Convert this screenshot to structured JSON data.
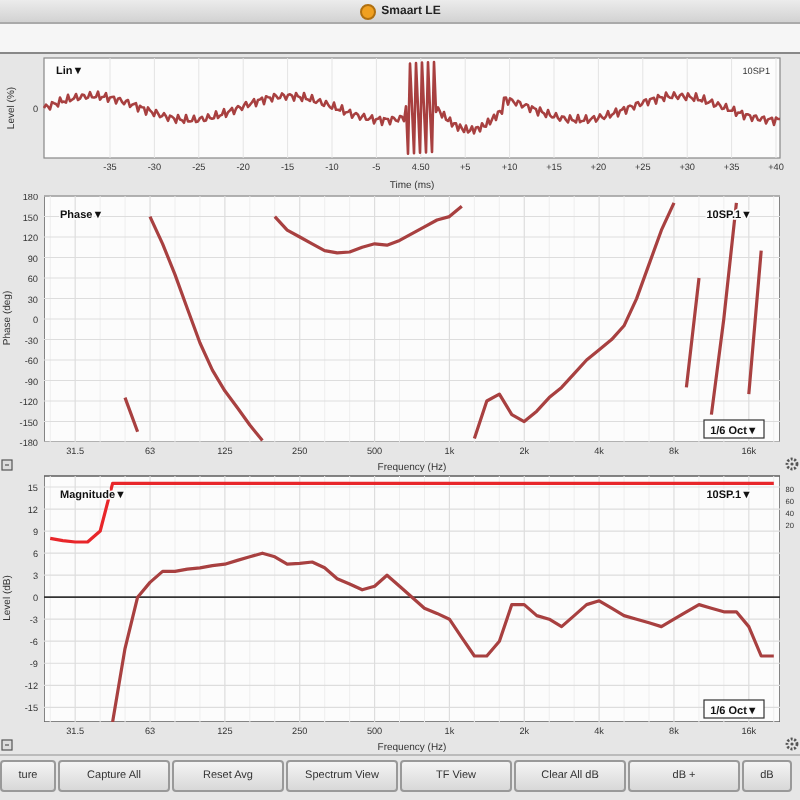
{
  "window": {
    "title": "Smaart LE"
  },
  "time_plot": {
    "mode": "Lin▼",
    "trace": "10SP1",
    "ylabel": "Level (%)",
    "xlabel": "Time (ms)",
    "yticks": [
      "0"
    ],
    "xticks": [
      "-35",
      "-30",
      "-25",
      "-20",
      "-15",
      "-10",
      "-5",
      "4.50",
      "+5",
      "+10",
      "+15",
      "+20",
      "+25",
      "+30",
      "+35",
      "+40"
    ]
  },
  "phase_plot": {
    "mode": "Phase▼",
    "trace": "10SP.1▼",
    "smoothing": "1/6 Oct▼",
    "chart_data": {
      "type": "line",
      "xlabel": "Frequency (Hz)",
      "ylabel": "Phase (deg)",
      "categories": [
        null,
        null,
        "31.5",
        null,
        null,
        null,
        null,
        null,
        "63",
        null,
        null,
        null,
        null,
        null,
        "125",
        null,
        null,
        null,
        null,
        null,
        "250",
        null,
        null,
        null,
        null,
        null,
        "500",
        null,
        null,
        null,
        null,
        null,
        "1k",
        null,
        null,
        null,
        null,
        null,
        "2k",
        null,
        null,
        null,
        null,
        null,
        "4k",
        null,
        null,
        null,
        null,
        null,
        "8k",
        null,
        null,
        null,
        null,
        null,
        "16k",
        null,
        null
      ],
      "series": [
        {
          "color": "#a84040",
          "values": [
            null,
            null,
            null,
            null,
            null,
            null,
            -115,
            -165,
            null,
            null,
            null,
            null,
            null,
            null,
            null,
            null,
            null,
            null,
            150,
            130,
            120,
            110,
            100,
            97,
            98,
            105,
            110,
            108,
            115,
            125,
            135,
            145,
            150,
            165,
            null,
            null,
            null,
            null,
            null,
            null,
            null,
            null,
            null,
            null,
            null,
            null,
            null,
            null,
            null,
            null,
            null,
            -100,
            60,
            null,
            null,
            null,
            -110,
            100,
            null
          ]
        },
        {
          "color": "#a84040",
          "values": [
            null,
            null,
            null,
            null,
            null,
            null,
            null,
            null,
            150,
            110,
            65,
            15,
            -35,
            -75,
            -105,
            -130,
            -155,
            -178,
            null,
            null,
            null,
            null,
            null,
            null,
            null,
            null,
            null,
            null,
            null,
            null,
            null,
            null,
            null,
            null,
            -175,
            -120,
            -110,
            -140,
            -150,
            -135,
            -115,
            -100,
            -80,
            -60,
            -45,
            -30,
            -10,
            30,
            80,
            130,
            170,
            null,
            null,
            -140,
            0,
            170,
            null,
            null,
            null
          ]
        }
      ],
      "grid": true,
      "ylim": [
        -180,
        180
      ],
      "yticks": [
        180,
        150,
        120,
        90,
        60,
        30,
        0,
        -30,
        -60,
        -90,
        -120,
        -150,
        -180
      ]
    }
  },
  "magnitude_plot": {
    "mode": "Magnitude▼",
    "trace": "10SP.1▼",
    "smoothing": "1/6 Oct▼",
    "coherence_ticks": [
      "80",
      "60",
      "40",
      "20"
    ],
    "chart_data": {
      "type": "line",
      "xlabel": "Frequency (Hz)",
      "ylabel": "Level (dB)",
      "categories": [
        null,
        null,
        "31.5",
        null,
        null,
        null,
        null,
        null,
        "63",
        null,
        null,
        null,
        null,
        null,
        "125",
        null,
        null,
        null,
        null,
        null,
        "250",
        null,
        null,
        null,
        null,
        null,
        "500",
        null,
        null,
        null,
        null,
        null,
        "1k",
        null,
        null,
        null,
        null,
        null,
        "2k",
        null,
        null,
        null,
        null,
        null,
        "4k",
        null,
        null,
        null,
        null,
        null,
        "8k",
        null,
        null,
        null,
        null,
        null,
        "16k",
        null,
        null
      ],
      "series": [
        {
          "color": "#e8262a",
          "values": [
            8,
            7.7,
            7.5,
            7.5,
            9,
            15.5,
            15.5,
            15.5,
            15.5,
            15.5,
            15.5,
            15.5,
            15.5,
            15.5,
            15.5,
            15.5,
            15.5,
            15.5,
            15.5,
            15.5,
            15.5,
            15.5,
            15.5,
            15.5,
            15.5,
            15.5,
            15.5,
            15.5,
            15.5,
            15.5,
            15.5,
            15.5,
            15.5,
            15.5,
            15.5,
            15.5,
            15.5,
            15.5,
            15.5,
            15.5,
            15.5,
            15.5,
            15.5,
            15.5,
            15.5,
            15.5,
            15.5,
            15.5,
            15.5,
            15.5,
            15.5,
            15.5,
            15.5,
            15.5,
            15.5,
            15.5,
            15.5,
            15.5,
            15.5
          ]
        },
        {
          "color": "#a84040",
          "values": [
            null,
            null,
            null,
            null,
            null,
            -17,
            -7,
            0,
            2,
            3.5,
            3.5,
            3.8,
            4,
            4.3,
            4.5,
            5,
            5.5,
            6,
            5.5,
            4.5,
            4.6,
            4.8,
            4,
            2.5,
            1.8,
            1,
            1.5,
            3,
            1.5,
            0,
            -1.5,
            -2.2,
            -3,
            -5.5,
            -8,
            -8,
            -6,
            -1,
            -1,
            -2.5,
            -3,
            -4,
            -2.5,
            -1,
            -0.5,
            -1.5,
            -2.5,
            -3,
            -3.5,
            -4,
            -3,
            -2,
            -1,
            -1.5,
            -2,
            -2,
            -4,
            -8,
            -8
          ]
        }
      ],
      "grid": true,
      "ylim": [
        -17,
        16.5
      ],
      "yticks": [
        15,
        12,
        9,
        6,
        3,
        0,
        -3,
        -6,
        -9,
        -12,
        -15
      ]
    }
  },
  "buttons": [
    "ture",
    "Capture All",
    "Reset Avg",
    "Spectrum View",
    "TF View",
    "Clear All dB",
    "dB +",
    "dB"
  ]
}
